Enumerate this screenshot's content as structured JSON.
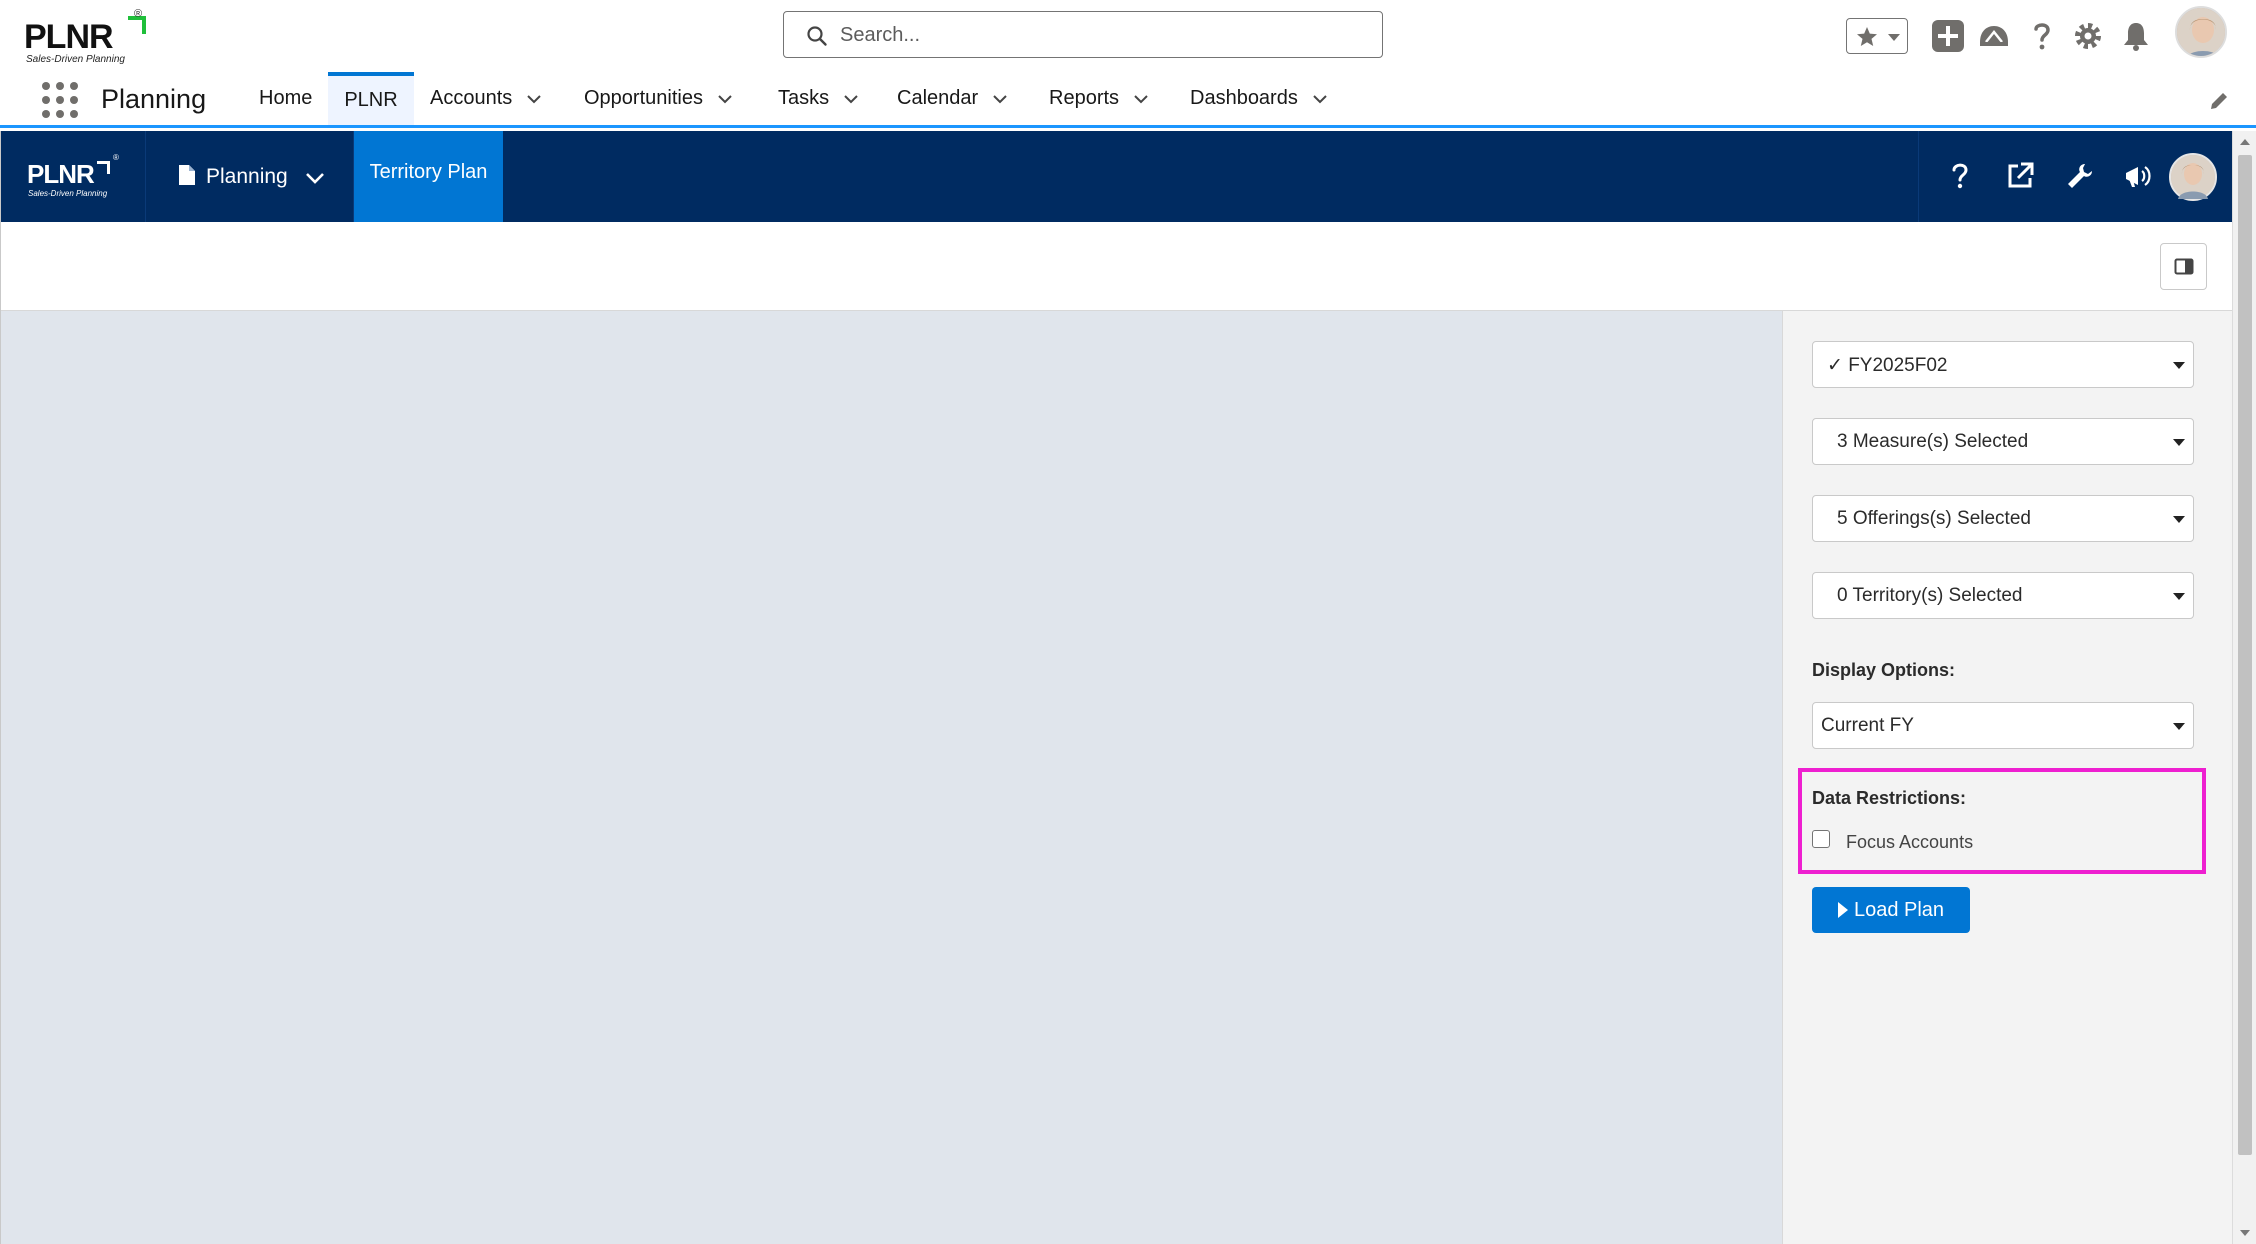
{
  "brand": {
    "logo_text": "PLNR",
    "tagline": "Sales-Driven Planning",
    "registered": "®"
  },
  "search": {
    "placeholder": "Search..."
  },
  "header_icons": [
    "favorites-star-icon",
    "add-icon",
    "trailhead-icon",
    "help-icon",
    "setup-gear-icon",
    "notifications-bell-icon",
    "user-avatar"
  ],
  "nav": {
    "app_name": "Planning",
    "items": [
      {
        "label": "Home",
        "has_menu": false,
        "active": false
      },
      {
        "label": "PLNR",
        "has_menu": false,
        "active": true
      },
      {
        "label": "Accounts",
        "has_menu": true,
        "active": false
      },
      {
        "label": "Opportunities",
        "has_menu": true,
        "active": false
      },
      {
        "label": "Tasks",
        "has_menu": true,
        "active": false
      },
      {
        "label": "Calendar",
        "has_menu": true,
        "active": false
      },
      {
        "label": "Reports",
        "has_menu": true,
        "active": false
      },
      {
        "label": "Dashboards",
        "has_menu": true,
        "active": false
      }
    ]
  },
  "app_header": {
    "menu_label": "Planning",
    "active_tab": "Territory Plan",
    "right_icons": [
      "help-icon",
      "external-link-icon",
      "wrench-icon",
      "announcement-icon",
      "user-avatar"
    ]
  },
  "panel": {
    "period_select": "✓ FY2025F02",
    "measures_select": "3 Measure(s) Selected",
    "offerings_select": "5 Offerings(s) Selected",
    "territory_select": "0 Territory(s) Selected",
    "display_options_label": "Display Options:",
    "display_options_value": "Current FY",
    "data_restrictions_label": "Data Restrictions:",
    "focus_accounts_label": "Focus Accounts",
    "focus_accounts_checked": false,
    "load_button": "Load Plan"
  },
  "colors": {
    "app_header_bg": "#002b61",
    "accent_blue": "#0176d3",
    "highlight_magenta": "#ee1fd0",
    "content_bg": "#e0e5ec"
  }
}
